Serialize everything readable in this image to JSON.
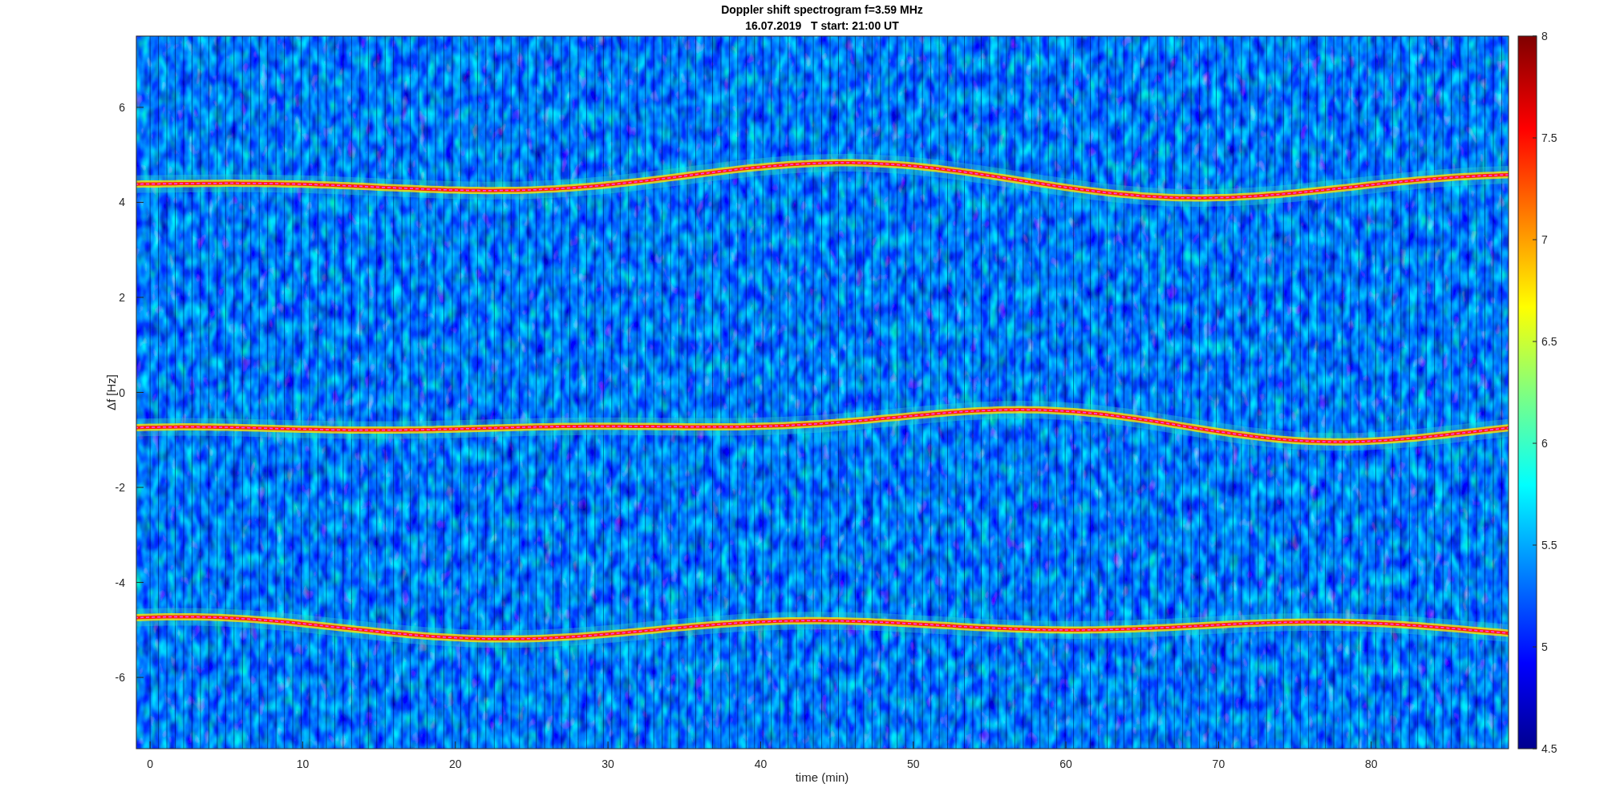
{
  "figure": {
    "title": "Doppler shift spectrogram f=3.59 MHz",
    "subtitle": "16.07.2019   T start: 21:00 UT",
    "xlabel": "time (min)",
    "ylabel": "Δf [Hz]",
    "xticks": [
      "0",
      "10",
      "20",
      "30",
      "40",
      "50",
      "60",
      "70",
      "80"
    ],
    "yticks": [
      "6",
      "4",
      "2",
      "0",
      "-2",
      "-4",
      "-6"
    ],
    "colorbar_ticks": [
      "8",
      "7.5",
      "7",
      "6.5",
      "6",
      "5.5",
      "5",
      "4.5"
    ]
  }
}
